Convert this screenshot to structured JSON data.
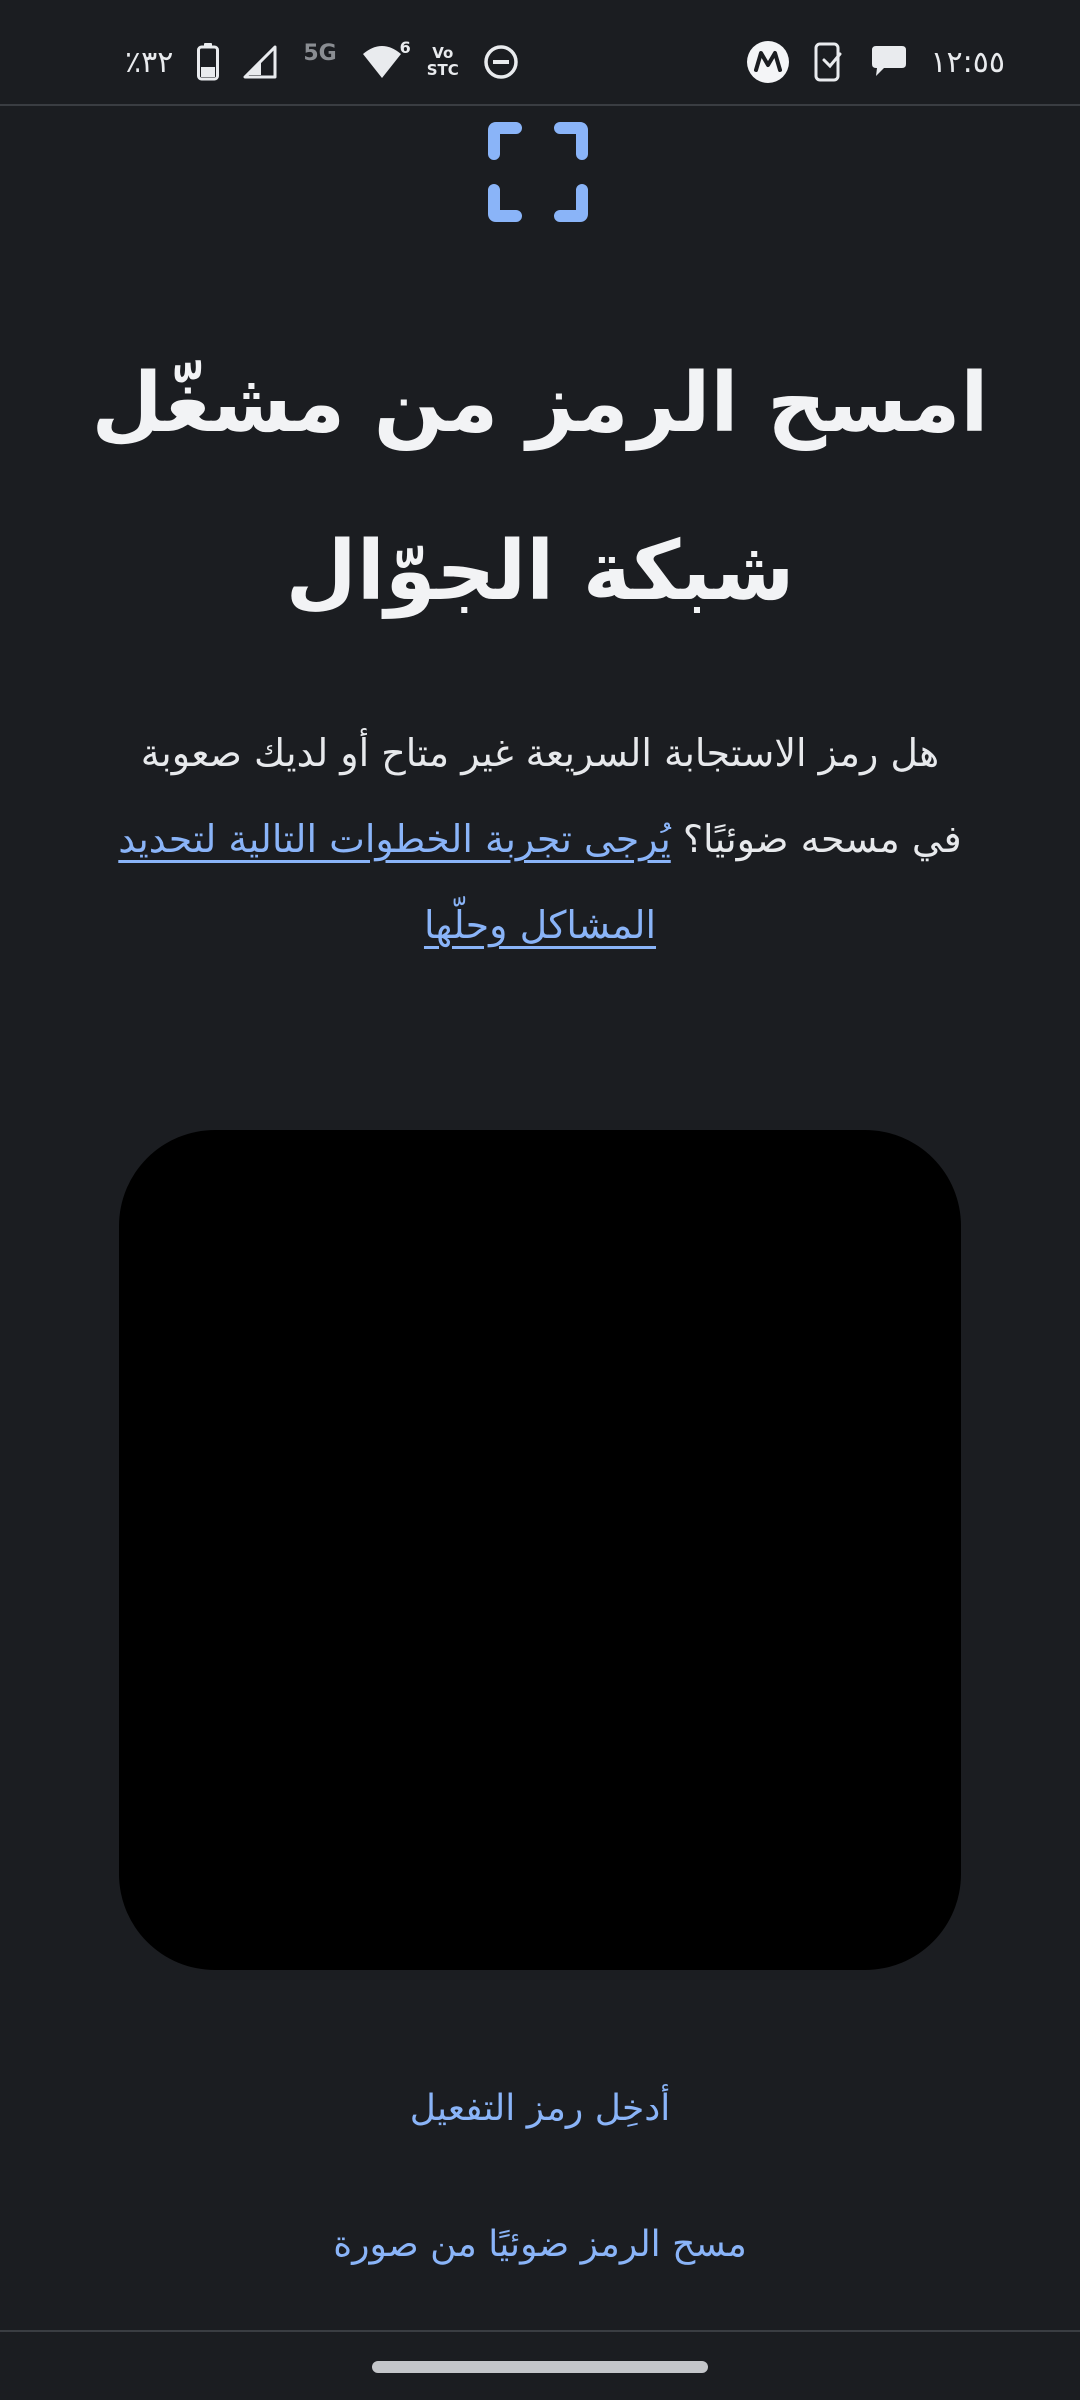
{
  "status_bar": {
    "battery_text": "٪٣٢",
    "network_badge": "5G",
    "wifi_badge": "6",
    "volte_top": "Vo",
    "volte_bottom": "STC",
    "time": "١٢:٥٥",
    "icons": [
      "battery-icon",
      "signal-icon",
      "wifi-icon",
      "volte-icon",
      "dnd-icon",
      "motorola-icon",
      "phone-sync-icon",
      "chat-icon"
    ]
  },
  "header": {
    "icon": "qr-scan-frame-icon",
    "accent_color": "#8ab4f8",
    "title_line1": "امسح الرمز من مشغّل",
    "title_line2": "شبكة الجوّال"
  },
  "description": {
    "text": "هل رمز الاستجابة السريعة غير متاح أو لديك صعوبة في مسحه ضوئيًا؟",
    "link_text": "يُرجى تجربة الخطوات التالية لتحديد المشاكل وحلّها"
  },
  "actions": {
    "enter_code": "أدخِل رمز التفعيل",
    "scan_from_image": "مسح الرمز ضوئيًا من صورة"
  }
}
